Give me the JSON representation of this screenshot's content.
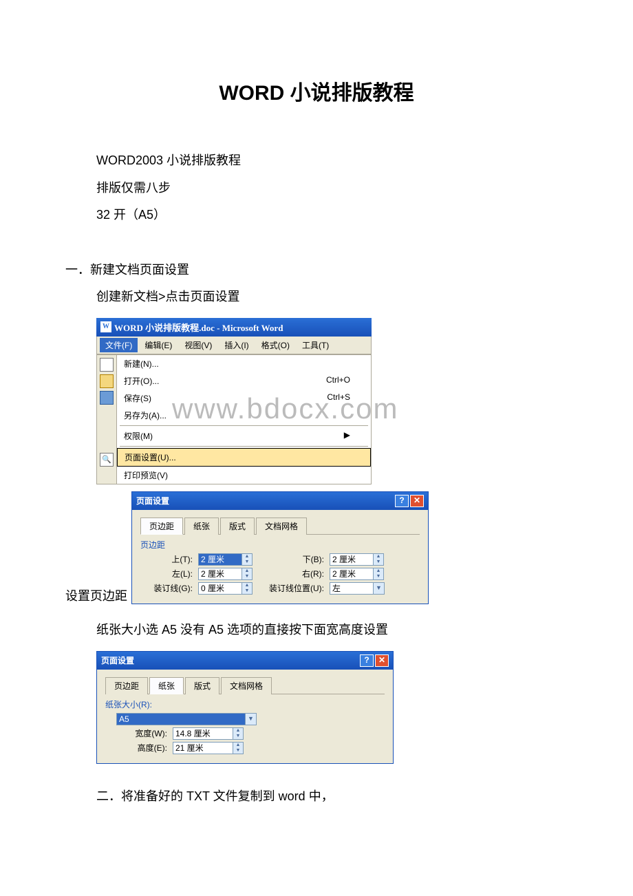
{
  "title": "WORD 小说排版教程",
  "intro": {
    "line1": "WORD2003 小说排版教程",
    "line2": "排版仅需八步",
    "line3": "32 开（A5）"
  },
  "section1": {
    "heading": "一．新建文档页面设置",
    "sub": "创建新文档>点击页面设置"
  },
  "word_window": {
    "title": "WORD 小说排版教程.doc - Microsoft Word",
    "menus": [
      "文件(F)",
      "编辑(E)",
      "视图(V)",
      "插入(I)",
      "格式(O)",
      "工具(T)"
    ],
    "file_menu": [
      {
        "label": "新建(N)...",
        "shortcut": ""
      },
      {
        "label": "打开(O)...",
        "shortcut": "Ctrl+O"
      },
      {
        "label": "保存(S)",
        "shortcut": "Ctrl+S"
      },
      {
        "label": "另存为(A)...",
        "shortcut": ""
      },
      {
        "label": "权限(M)",
        "shortcut": "▶"
      },
      {
        "label": "页面设置(U)...",
        "shortcut": "",
        "highlighted": true
      },
      {
        "label": "打印预览(V)",
        "shortcut": ""
      }
    ]
  },
  "watermark": "www.bdocx.com",
  "page_setup1": {
    "prefix_label": "设置页边距",
    "title": "页面设置",
    "tabs": [
      "页边距",
      "纸张",
      "版式",
      "文档网格"
    ],
    "active_tab": 0,
    "group": "页边距",
    "fields": {
      "top_label": "上(T):",
      "top_value": "2 厘米",
      "bottom_label": "下(B):",
      "bottom_value": "2 厘米",
      "left_label": "左(L):",
      "left_value": "2 厘米",
      "right_label": "右(R):",
      "right_value": "2 厘米",
      "gutter_label": "装订线(G):",
      "gutter_value": "0 厘米",
      "gutter_pos_label": "装订线位置(U):",
      "gutter_pos_value": "左"
    }
  },
  "paper_note": "纸张大小选 A5 没有 A5 选项的直接按下面宽高度设置",
  "page_setup2": {
    "title": "页面设置",
    "tabs": [
      "页边距",
      "纸张",
      "版式",
      "文档网格"
    ],
    "active_tab": 1,
    "group": "纸张大小(R):",
    "paper_size": "A5",
    "width_label": "宽度(W):",
    "width_value": "14.8 厘米",
    "height_label": "高度(E):",
    "height_value": "21 厘米"
  },
  "section2": "二．将准备好的 TXT 文件复制到 word 中，"
}
